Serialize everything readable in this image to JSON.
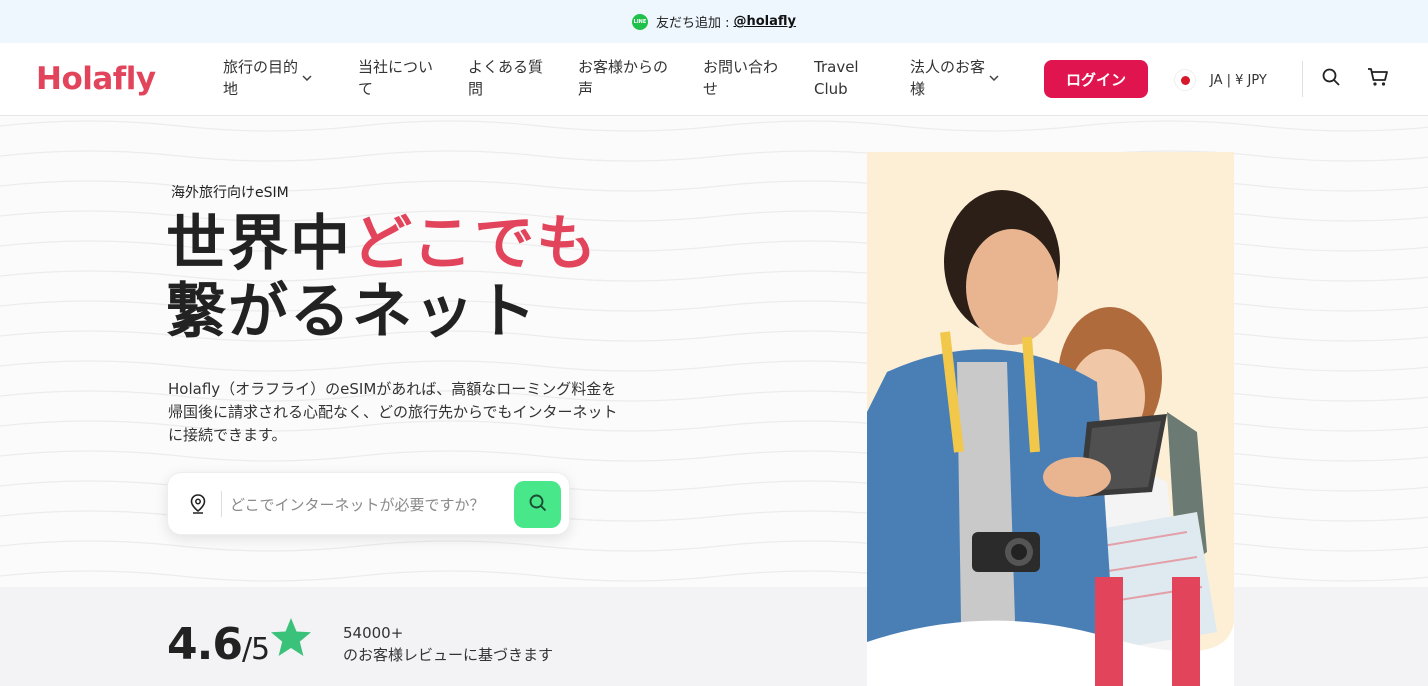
{
  "topbar": {
    "line_icon": "LINE",
    "text": "友だち追加 :",
    "handle": "@holafly"
  },
  "header": {
    "logo": "Holafly",
    "nav": [
      {
        "label": "旅行の目的\n地",
        "has_dropdown": true
      },
      {
        "label": "当社につい\nて",
        "has_dropdown": false
      },
      {
        "label": "よくある質\n問",
        "has_dropdown": false
      },
      {
        "label": "お客様からの\n声",
        "has_dropdown": false
      },
      {
        "label": "お問い合わ\nせ",
        "has_dropdown": false
      },
      {
        "label": "Travel\nClub",
        "has_dropdown": false
      },
      {
        "label": "法人のお客\n様",
        "has_dropdown": true
      }
    ],
    "login": "ログイン",
    "language": "JA | ¥ JPY",
    "icons": [
      "search-icon",
      "cart-icon"
    ]
  },
  "hero": {
    "eyebrow": "海外旅行向けeSIM",
    "headline_part1": "世界中",
    "headline_accent": "どこでも",
    "headline_line2": "繋がるネット",
    "description": "Holafly（オラフライ）のeSIMがあれば、高額なローミング料金を帰国後に請求される心配なく、どの旅行先からでもインターネットに接続できます。",
    "search": {
      "placeholder": "どこでインターネットが必要ですか？",
      "value": ""
    }
  },
  "rating": {
    "score": "4.6",
    "out_of": "/5",
    "count": "54000+",
    "caption": "のお客様レビューに基づきます"
  },
  "colors": {
    "brand": "#e2455b",
    "login": "#e0154f",
    "search_button": "#48e88a",
    "star": "#3bc27a"
  }
}
